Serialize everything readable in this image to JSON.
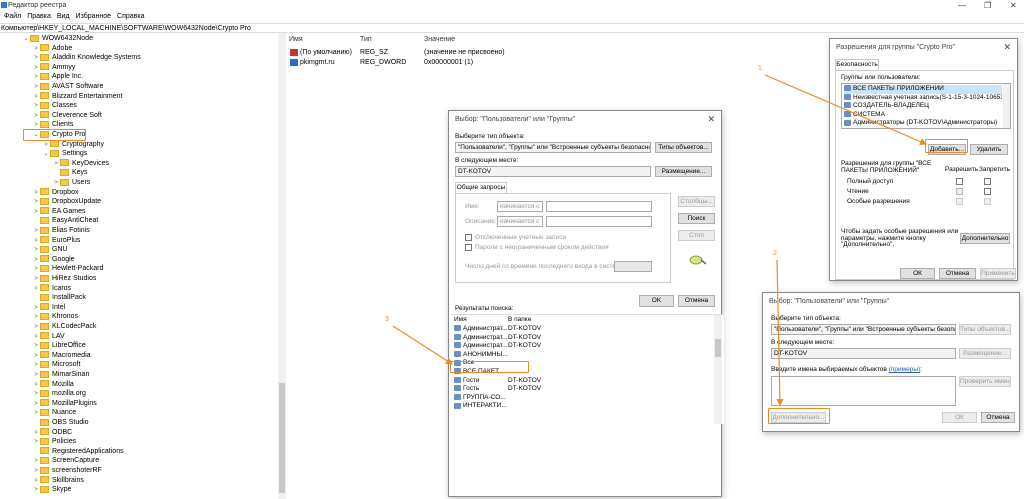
{
  "window": {
    "title": "Редактор реестра",
    "controls": [
      "—",
      "❐",
      "✕"
    ]
  },
  "menu": [
    "Файл",
    "Правка",
    "Вид",
    "Избранное",
    "Справка"
  ],
  "address": "Компьютер\\HKEY_LOCAL_MACHINE\\SOFTWARE\\WOW6432Node\\Crypto Pro",
  "tree": [
    {
      "label": "WOW6432Node",
      "level": 0,
      "exp": "⌄"
    },
    {
      "label": "Adobe",
      "level": 1,
      "exp": ">"
    },
    {
      "label": "Aladdin Knowledge Systems",
      "level": 1,
      "exp": ">"
    },
    {
      "label": "Ammyy",
      "level": 1,
      "exp": ">"
    },
    {
      "label": "Apple Inc.",
      "level": 1,
      "exp": ">"
    },
    {
      "label": "AVAST Software",
      "level": 1,
      "exp": ">"
    },
    {
      "label": "Blizzard Entertainment",
      "level": 1,
      "exp": ">"
    },
    {
      "label": "Classes",
      "level": 1,
      "exp": ">"
    },
    {
      "label": "Cleverence Soft",
      "level": 1,
      "exp": ">"
    },
    {
      "label": "Clients",
      "level": 1,
      "exp": ">"
    },
    {
      "label": "Crypto Pro",
      "level": 1,
      "exp": "⌄"
    },
    {
      "label": "Cryptography",
      "level": 2,
      "exp": ">"
    },
    {
      "label": "Settings",
      "level": 2,
      "exp": "⌄"
    },
    {
      "label": "KeyDevices",
      "level": 3,
      "exp": ">"
    },
    {
      "label": "Keys",
      "level": 3,
      "exp": ""
    },
    {
      "label": "Users",
      "level": 3,
      "exp": ">"
    },
    {
      "label": "Dropbox",
      "level": 1,
      "exp": ">"
    },
    {
      "label": "DropboxUpdate",
      "level": 1,
      "exp": ">"
    },
    {
      "label": "EA Games",
      "level": 1,
      "exp": ">"
    },
    {
      "label": "EasyAntiCheat",
      "level": 1,
      "exp": ""
    },
    {
      "label": "Elias Fotinis",
      "level": 1,
      "exp": ">"
    },
    {
      "label": "EuroPlus",
      "level": 1,
      "exp": ">"
    },
    {
      "label": "GNU",
      "level": 1,
      "exp": ">"
    },
    {
      "label": "Google",
      "level": 1,
      "exp": ">"
    },
    {
      "label": "Hewlett-Packard",
      "level": 1,
      "exp": ">"
    },
    {
      "label": "HiRez Studios",
      "level": 1,
      "exp": ">"
    },
    {
      "label": "Icaros",
      "level": 1,
      "exp": ">"
    },
    {
      "label": "InstallPack",
      "level": 1,
      "exp": ""
    },
    {
      "label": "Intel",
      "level": 1,
      "exp": ">"
    },
    {
      "label": "Khronos",
      "level": 1,
      "exp": ">"
    },
    {
      "label": "KLCodecPack",
      "level": 1,
      "exp": ">"
    },
    {
      "label": "LAV",
      "level": 1,
      "exp": ">"
    },
    {
      "label": "LibreOffice",
      "level": 1,
      "exp": ">"
    },
    {
      "label": "Macromedia",
      "level": 1,
      "exp": ">"
    },
    {
      "label": "Microsoft",
      "level": 1,
      "exp": ">"
    },
    {
      "label": "MimarSinan",
      "level": 1,
      "exp": ">"
    },
    {
      "label": "Mozilla",
      "level": 1,
      "exp": ">"
    },
    {
      "label": "mozilla.org",
      "level": 1,
      "exp": ">"
    },
    {
      "label": "MozillaPlugins",
      "level": 1,
      "exp": ">"
    },
    {
      "label": "Nuance",
      "level": 1,
      "exp": ">"
    },
    {
      "label": "OBS Studio",
      "level": 1,
      "exp": ""
    },
    {
      "label": "ODBC",
      "level": 1,
      "exp": ">"
    },
    {
      "label": "Policies",
      "level": 1,
      "exp": ">"
    },
    {
      "label": "RegisteredApplications",
      "level": 1,
      "exp": ""
    },
    {
      "label": "ScreenCapture",
      "level": 1,
      "exp": ">"
    },
    {
      "label": "screenshoterRF",
      "level": 1,
      "exp": ">"
    },
    {
      "label": "Skillbrains",
      "level": 1,
      "exp": ">"
    },
    {
      "label": "Skype",
      "level": 1,
      "exp": ">"
    }
  ],
  "values": {
    "headers": [
      "Имя",
      "Тип",
      "Значение"
    ],
    "rows": [
      {
        "name": "(По умолчанию)",
        "type": "REG_SZ",
        "value": "(значение не присвоено)",
        "color": "#c0392b"
      },
      {
        "name": "pkimgmt.ru",
        "type": "REG_DWORD",
        "value": "0x00000001 (1)",
        "color": "#2d6cc0"
      }
    ]
  },
  "perm_dialog": {
    "title": "Разрешения для группы \"Crypto Pro\"",
    "tab": "Безопасность",
    "groups_label": "Группы или пользователи:",
    "groups": [
      "ВСЕ ПАКЕТЫ ПРИЛОЖЕНИЙ",
      "Неизвестная учетная запись(S-1-15-3-1024-106536593",
      "СОЗДАТЕЛЬ-ВЛАДЕЛЕЦ",
      "СИСТЕМА",
      "Администраторы (DT-KOTOV\\Администраторы)"
    ],
    "add": "Добавить...",
    "remove": "Удалить",
    "perm_label": "Разрешения для группы \"ВСЕ ПАКЕТЫ ПРИЛОЖЕНИЙ\"",
    "allow": "Разрешить",
    "deny": "Запретить",
    "perms": [
      "Полный доступ",
      "Чтение",
      "Особые разрешения"
    ],
    "advanced_text": "Чтобы задать особые разрешения или параметры, нажмите кнопку \"Дополнительно\".",
    "advanced": "Дополнительно",
    "ok": "ОК",
    "cancel": "Отмена",
    "apply": "Применить"
  },
  "select_big": {
    "title": "Выбор: \"Пользователи\" или \"Группы\"",
    "type_label": "Выберите тип объекта:",
    "type_value": "\"Пользователи\", \"Группы\" или \"Встроенные субъекты безопасности\"",
    "types_btn": "Типы объектов...",
    "location_label": "В следующем месте:",
    "location_value": "DT-KOTOV",
    "location_btn": "Размещение...",
    "tab": "Общие запросы",
    "name_label": "Имя:",
    "desc_label": "Описание:",
    "starts_with": "начинается с",
    "disabled_accounts": "Отключенные учетные записи",
    "no_expire": "Пароли с неограниченным сроком действия",
    "days_label": "Число дней со времени последнего входа в систему:",
    "columns_btn": "Столбцы...",
    "find_btn": "Поиск",
    "stop_btn": "Стоп",
    "results_label": "Результаты поиска:",
    "ok": "OK",
    "cancel": "Отмена",
    "col_name": "Имя",
    "col_folder": "В папке",
    "results": [
      {
        "name": "Администрат...",
        "folder": "DT-KOTOV"
      },
      {
        "name": "Администрат...",
        "folder": "DT-KOTOV"
      },
      {
        "name": "Администрат...",
        "folder": "DT-KOTOV"
      },
      {
        "name": "АНОНИМНЫ...",
        "folder": ""
      },
      {
        "name": "Все",
        "folder": ""
      },
      {
        "name": "ВСЕ ПАКЕТ...",
        "folder": ""
      },
      {
        "name": "Гости",
        "folder": "DT-KOTOV"
      },
      {
        "name": "Гость",
        "folder": "DT-KOTOV"
      },
      {
        "name": "ГРУППА-СО...",
        "folder": ""
      },
      {
        "name": "ИНТЕРАКТИ...",
        "folder": ""
      }
    ]
  },
  "select_small": {
    "title": "Выбор: \"Пользователи\" или \"Группы\"",
    "type_label": "Выберите тип объекта:",
    "type_value": "\"Пользователи\", \"Группы\" или \"Встроенные субъекты безопаснос",
    "types_btn": "Типы объектов...",
    "location_label": "В следующем месте:",
    "location_value": "DT-KOTOV",
    "location_btn": "Размещение...",
    "names_label": "Введите имена выбираемых объектов",
    "names_link": "(примеры)",
    "check_btn": "Проверить имена",
    "advanced_btn": "Дополнительно...",
    "ok": "ОК",
    "cancel": "Отмена"
  },
  "annotations": [
    "1",
    "2",
    "3"
  ]
}
